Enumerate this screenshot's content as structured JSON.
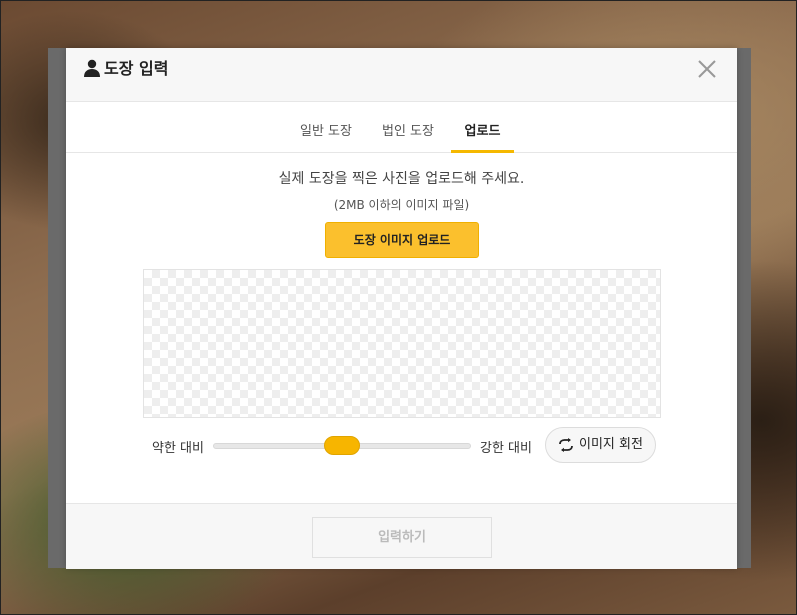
{
  "modal": {
    "title": "도장 입력",
    "tabs": [
      {
        "label": "일반 도장",
        "active": false
      },
      {
        "label": "법인 도장",
        "active": false
      },
      {
        "label": "업로드",
        "active": true
      }
    ],
    "description": "실제 도장을 찍은 사진을 업로드해 주세요.",
    "file_limit": "(2MB 이하의 이미지 파일)",
    "upload_button": "도장 이미지 업로드",
    "contrast": {
      "low_label": "약한 대비",
      "high_label": "강한 대비",
      "level": 0.5
    },
    "rotate_button": "이미지 회전",
    "submit_button": "입력하기",
    "icons": {
      "title": "user-icon",
      "close": "close-icon",
      "rotate": "rotate-icon"
    },
    "colors": {
      "accent": "#fbc02d",
      "active_tab_underline": "#f5b800"
    }
  }
}
